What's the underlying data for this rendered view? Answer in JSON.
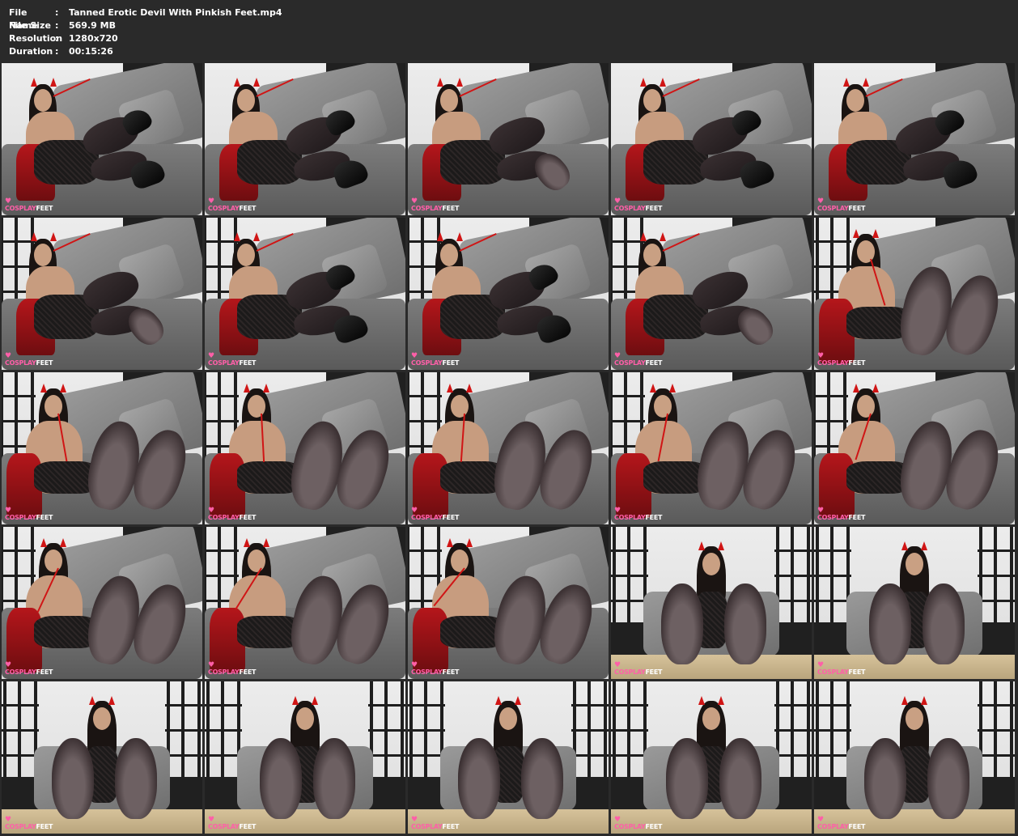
{
  "file_info": {
    "rows": [
      {
        "key": "File Name",
        "sep": ":",
        "value": "Tanned Erotic Devil With Pinkish Feet.mp4"
      },
      {
        "key": "File Size",
        "sep": ":",
        "value": "569.9 MB"
      },
      {
        "key": "Resolution",
        "sep": ":",
        "value": "1280x720"
      },
      {
        "key": "Duration",
        "sep": ":",
        "value": "00:15:26"
      }
    ]
  },
  "watermark": {
    "part1": "COSPLAY",
    "part2": "FEET",
    "heart": "♥"
  },
  "colors": {
    "background": "#2a2a2a",
    "accent": "#ff5fa8",
    "horn": "#d01515"
  }
}
